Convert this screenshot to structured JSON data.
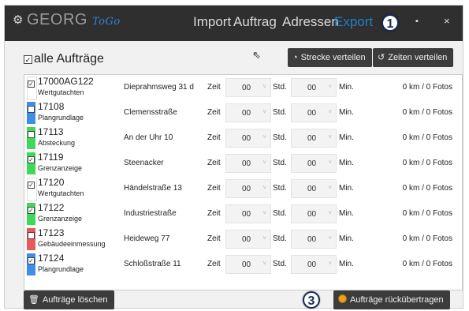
{
  "app": {
    "icon": "gear-icon",
    "brand": "GEORG",
    "brand_suffix": "ToGo",
    "brand_suffix_color": "#2f86d6",
    "accent_color": "#1e7fd0",
    "titlebar_color": "#2f2f2f"
  },
  "nav": {
    "items": [
      {
        "label": "Import",
        "active": false
      },
      {
        "label": "Auftrag",
        "active": false
      },
      {
        "label": "Adressen",
        "active": false
      },
      {
        "label": "Export",
        "active": true
      }
    ]
  },
  "window": {
    "maximize_icon": "maximize-icon",
    "close_icon": "close-icon",
    "maximize_glyph": "▪",
    "close_glyph": "×"
  },
  "badges": [
    "1",
    "2",
    "3"
  ],
  "toolbar": {
    "all_orders_label": "alle Aufträge",
    "all_orders_checked": true,
    "distribute_route_label": "Strecke verteilen",
    "distribute_route_icon": "gauge-icon",
    "distribute_times_label": "Zeiten verteilen",
    "distribute_times_icon": "history-icon"
  },
  "labels": {
    "time": "Zeit",
    "hours": "Std.",
    "minutes": "Min."
  },
  "orders": [
    {
      "number": "17000AG122",
      "type": "Wertgutachten",
      "street": "Dieprahmsweg 31 d",
      "hours": "00",
      "minutes": "00",
      "stats": "0 km / 0 Fotos",
      "color": "#ffffff",
      "checked": true
    },
    {
      "number": "17108",
      "type": "Plangrundlage",
      "street": "Clemensstraße",
      "hours": "00",
      "minutes": "00",
      "stats": "0 km / 0 Fotos",
      "color": "#3f8ee6",
      "checked": false
    },
    {
      "number": "17113",
      "type": "Absteckung",
      "street": "An der Uhr 10",
      "hours": "00",
      "minutes": "00",
      "stats": "0 km / 0 Fotos",
      "color": "#3fd95a",
      "checked": false
    },
    {
      "number": "17119",
      "type": "Grenzanzeige",
      "street": "Steenacker",
      "hours": "00",
      "minutes": "00",
      "stats": "0 km / 0 Fotos",
      "color": "#3fd95a",
      "checked": true
    },
    {
      "number": "17120",
      "type": "Wertgutachten",
      "street": "Händelstraße 13",
      "hours": "00",
      "minutes": "00",
      "stats": "0 km / 0 Fotos",
      "color": "#ffffff",
      "checked": true
    },
    {
      "number": "17122",
      "type": "Grenzanzeige",
      "street": "Industriestraße",
      "hours": "00",
      "minutes": "00",
      "stats": "0 km / 0 Fotos",
      "color": "#3fd95a",
      "checked": true
    },
    {
      "number": "17123",
      "type": "Gebäudeeinmessung",
      "street": "Heideweg 77",
      "hours": "00",
      "minutes": "00",
      "stats": "0 km / 0 Fotos",
      "color": "#e85a5a",
      "checked": false
    },
    {
      "number": "17124",
      "type": "Plangrundlage",
      "street": "Schloßstraße 11",
      "hours": "00",
      "minutes": "00",
      "stats": "0 km / 0 Fotos",
      "color": "#3f8ee6",
      "checked": true
    }
  ],
  "footer": {
    "delete_label": "Aufträge löschen",
    "delete_icon": "trash-icon",
    "retransfer_label": "Aufträge rückübertragen",
    "retransfer_icon": "coin-icon"
  }
}
